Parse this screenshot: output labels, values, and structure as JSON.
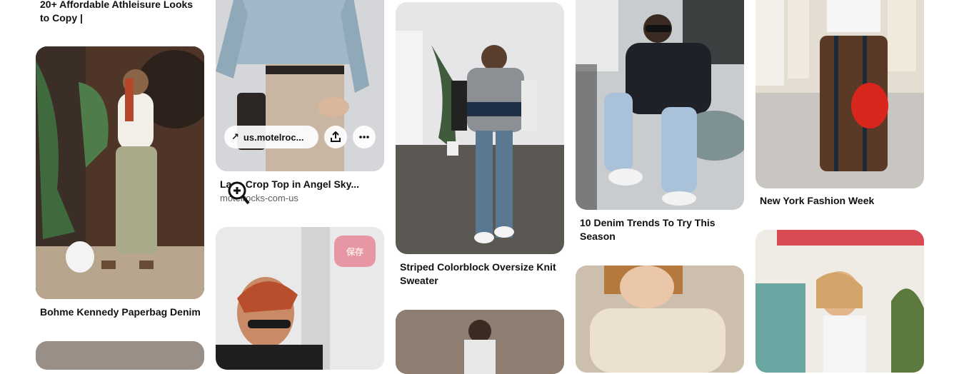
{
  "pins": {
    "p0": {
      "title": "20+ Affordable Athleisure Looks to Copy |"
    },
    "p1": {
      "title": "Bohme Kennedy Paperbag Denim"
    },
    "p2": {
      "title": "Lace Crop Top in Angel Sky...",
      "source": "motelrocks-com-us",
      "link_label": "us.motelroc..."
    },
    "p3": {
      "save_label": "保存"
    },
    "p4": {
      "title": "Striped Colorblock Oversize Knit Sweater"
    },
    "p5": {
      "title": "10 Denim Trends To Try This Season"
    },
    "p6": {
      "title": "New York Fashion Week"
    }
  },
  "colors": {
    "save_red": "#e60023"
  }
}
